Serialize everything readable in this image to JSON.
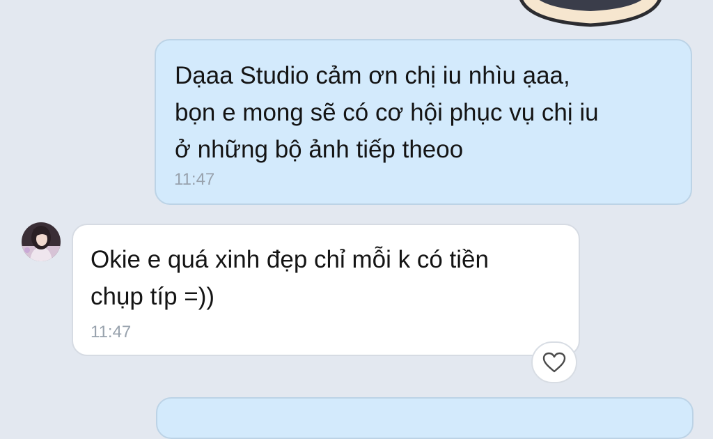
{
  "conversation": {
    "messages": [
      {
        "direction": "outgoing",
        "text": "Dạaa Studio cảm ơn chị iu nhìu ạaa,\nbọn e mong sẽ có cơ hội phục vụ chị iu\nở những bộ ảnh tiếp theoo",
        "time": "11:47"
      },
      {
        "direction": "incoming",
        "text": "Okie e quá xinh đẹp chỉ mỗi k có tiền\nchụp típ =))",
        "time": "11:47",
        "avatar_icon": "user-avatar",
        "reaction_icon": "heart-outline-icon"
      }
    ]
  },
  "colors": {
    "background": "#e3e8f0",
    "outgoing_bubble": "#d3eafc",
    "incoming_bubble": "#ffffff",
    "timestamp": "#98a2ad"
  }
}
